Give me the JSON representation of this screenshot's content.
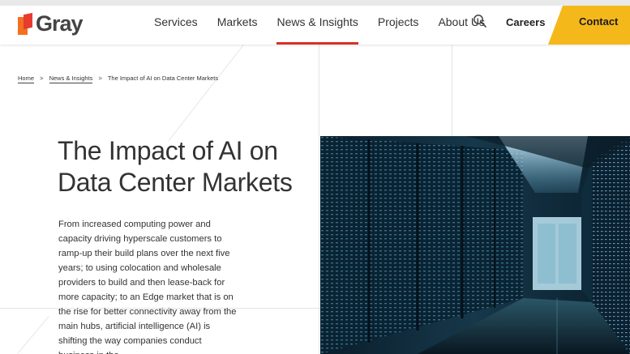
{
  "brand": {
    "name": "Gray",
    "colors": {
      "accent_red": "#d6322a",
      "logo_orange": "#f37021",
      "contact_yellow": "#f5b81b"
    }
  },
  "nav": {
    "items": [
      {
        "label": "Services",
        "active": false
      },
      {
        "label": "Markets",
        "active": false
      },
      {
        "label": "News & Insights",
        "active": true
      },
      {
        "label": "Projects",
        "active": false
      },
      {
        "label": "About Us",
        "active": false
      }
    ],
    "search_icon": "search-icon",
    "careers_label": "Careers",
    "contact_label": "Contact"
  },
  "breadcrumb": {
    "items": [
      "Home",
      "News & Insights",
      "The Impact of AI on Data Center Markets"
    ],
    "separator": ">"
  },
  "article": {
    "title_line1": "The Impact of AI on",
    "title_line2": "Data Center Markets",
    "intro": "From increased computing power and capacity driving hyperscale customers to ramp-up their build plans over the next five years; to using colocation and wholesale providers to build and then lease-back for more capacity; to an Edge market that is on the rise for better connectivity away from the main hubs, artificial intelligence (AI) is shifting the way companies conduct business in the"
  }
}
